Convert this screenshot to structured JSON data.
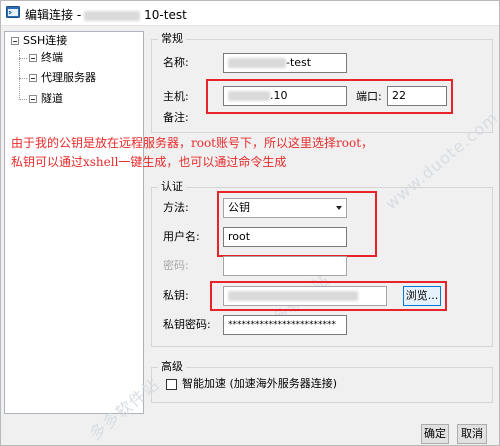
{
  "window": {
    "title_prefix": "编辑连接 -",
    "title_suffix": "10-test"
  },
  "tree": {
    "root_label": "SSH连接",
    "children": [
      "终端",
      "代理服务器",
      "隧道"
    ]
  },
  "general": {
    "group_title": "常规",
    "name_label": "名称:",
    "name_value_suffix": "-test",
    "host_label": "主机:",
    "host_value_suffix": ".10",
    "port_label": "端口:",
    "port_value": "22",
    "notes_label": "备注:"
  },
  "annotation": {
    "line1": "由于我的公钥是放在远程服务器，root账号下，所以这里选择root，",
    "line2": "私钥可以通过xshell一键生成，也可以通过命令生成"
  },
  "auth": {
    "group_title": "认证",
    "method_label": "方法:",
    "method_value": "公钥",
    "username_label": "用户名:",
    "username_value": "root",
    "password_label": "密码:",
    "password_value": "",
    "private_key_label": "私钥:",
    "browse_label": "浏览...",
    "passphrase_label": "私钥密码:",
    "passphrase_value": "************************"
  },
  "advanced": {
    "group_title": "高级",
    "smart_accel_label": "智能加速 (加速海外服务器连接)",
    "smart_accel_checked": false
  },
  "footer": {
    "ok_label": "确定",
    "cancel_label": "取消"
  },
  "watermark": {
    "cn": "多多软件站",
    "domain": "www.duote.com"
  },
  "colors": {
    "annotation_red": "#e8242b",
    "window_bg": "#f0f0f0"
  }
}
